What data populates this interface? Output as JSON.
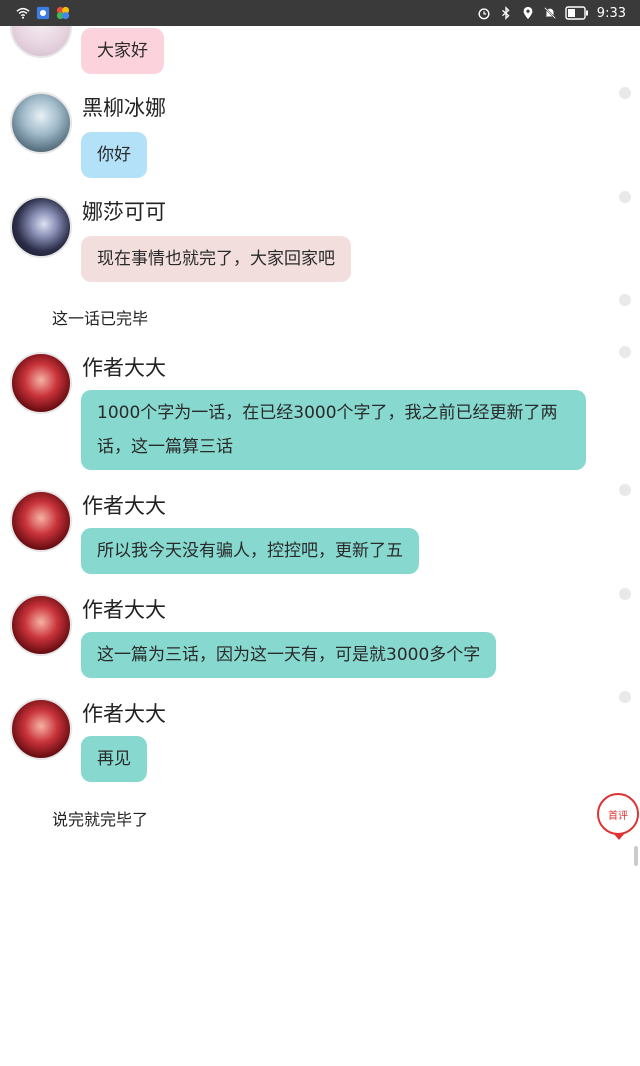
{
  "status_bar": {
    "time": "9:33"
  },
  "colors": {
    "pink": "#fcd3dc",
    "blue": "#b3e1f8",
    "rose": "#f3dede",
    "teal": "#87d8cf"
  },
  "messages": [
    {
      "name": "",
      "text": "大家好",
      "avatar": "pale-girl"
    },
    {
      "name": "黑柳冰娜",
      "text": "你好",
      "avatar": "silver-girl"
    },
    {
      "name": "娜莎可可",
      "text": "现在事情也就完了，大家回家吧",
      "avatar": "dark-moon-girl"
    },
    {
      "name": "作者大大",
      "text": "1000个字为一话，在已经3000个字了，我之前已经更新了两话，这一篇算三话",
      "avatar": "red-hair-girl"
    },
    {
      "name": "作者大大",
      "text": "所以我今天没有骗人，控控吧，更新了五",
      "avatar": "red-hair-girl"
    },
    {
      "name": "作者大大",
      "text": "这一篇为三话，因为这一天有，可是就3000多个字",
      "avatar": "red-hair-girl"
    },
    {
      "name": "作者大大",
      "text": "再见",
      "avatar": "red-hair-girl"
    }
  ],
  "notes": [
    "这一话已完毕",
    "说完就完毕了"
  ],
  "comment_button": {
    "label": "首评"
  }
}
